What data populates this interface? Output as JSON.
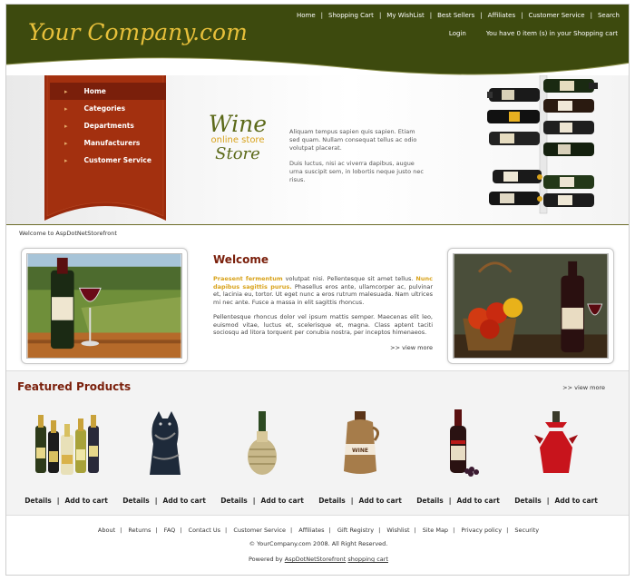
{
  "header": {
    "logo": "Your Company.com",
    "top_nav": [
      "Home",
      "Shopping Cart",
      "My WishList",
      "Best Sellers",
      "Affiliates",
      "Customer Service",
      "Search"
    ],
    "login": "Login",
    "cart_status": "You have 0 item (s) in your Shopping cart"
  },
  "hero": {
    "menu": [
      "Home",
      "Categories",
      "Departments",
      "Manufacturers",
      "Customer Service"
    ],
    "wine_logo": {
      "line1": "Wine",
      "line2": "online store",
      "line3": "Store"
    },
    "para1": "Aliquam tempus sapien quis sapien. Etiam sed quam. Nullam consequat tellus ac odio volutpat placerat.",
    "para2": "Duis luctus, nisi ac viverra dapibus, augue urna suscipit sem, in lobortis neque justo nec risus."
  },
  "welcome": {
    "strip": "Welcome to AspDotNetStorefront",
    "title": "Welcome",
    "highlight1": "Praesent fermentum",
    "text1a": " volutpat nisi. Pellentesque sit amet tellus. ",
    "highlight2": "Nunc dapibus sagittis purus.",
    "text1b": " Phasellus eros ante, ullamcorper ac, pulvinar et, lacinia eu, tortor. Ut eget nunc a eros rutrum malesuada. Nam ultrices mi nec ante. Fusce a massa in elit sagittis rhoncus.",
    "text2": "Pellentesque rhoncus dolor vel ipsum mattis semper. Maecenas elit leo, euismod vitae, luctus et, scelerisque et, magna. Class aptent taciti sociosqu ad litora torquent per conubia nostra, per inceptos himenaeos.",
    "view_more": ">> view more"
  },
  "featured": {
    "title": "Featured Products",
    "view_more": ">> view more",
    "details_label": "Details",
    "separator": "|",
    "add_label": "Add to cart",
    "product_icons": [
      "champagne-bottles-icon",
      "cat-bottle-icon",
      "wicker-bottle-icon",
      "wine-jug-icon",
      "wine-bottle-grapes-icon",
      "gift-wrapped-bottle-icon"
    ]
  },
  "footer": {
    "links": [
      "About",
      "Returns",
      "FAQ",
      "Contact Us",
      "Customer Service",
      "Affiliates",
      "Gift Registry",
      "Wishlist",
      "Site Map",
      "Privacy policy",
      "Security"
    ],
    "copyright": "© YourCompany.com 2008. All Right Reserved.",
    "powered_prefix": "Powered by ",
    "powered_link1": "AspDotNetStorefront",
    "powered_link2": "shopping cart"
  },
  "colors": {
    "header_bg": "#3d4a0e",
    "accent_red": "#7a1f0b",
    "logo_gold": "#e6bf3a",
    "highlight": "#d8a21a"
  }
}
